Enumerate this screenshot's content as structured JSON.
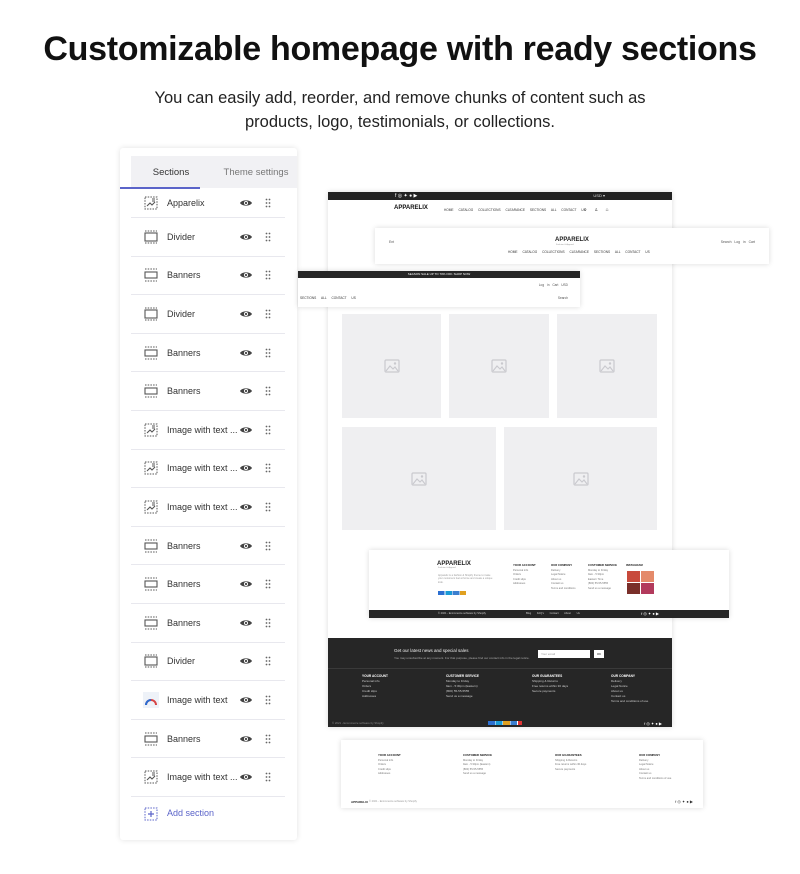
{
  "hero": {
    "title": "Customizable homepage with ready sections",
    "subtitle": "You can easily add, reorder, and remove chunks of content such as products, logo, testimonials, or collections."
  },
  "panel": {
    "tabs": [
      {
        "label": "Sections",
        "active": true
      },
      {
        "label": "Theme settings",
        "active": false
      }
    ],
    "sections": [
      {
        "label": "Apparelix",
        "icon": "image-text-icon"
      },
      {
        "label": "Divider",
        "icon": "divider-icon"
      },
      {
        "label": "Banners",
        "icon": "banner-icon"
      },
      {
        "label": "Divider",
        "icon": "divider-icon"
      },
      {
        "label": "Banners",
        "icon": "banner-icon"
      },
      {
        "label": "Banners",
        "icon": "banner-icon"
      },
      {
        "label": "Image with text ...",
        "icon": "image-text-icon"
      },
      {
        "label": "Image with text ...",
        "icon": "image-text-icon"
      },
      {
        "label": "Image with text ...",
        "icon": "image-text-icon"
      },
      {
        "label": "Banners",
        "icon": "banner-icon"
      },
      {
        "label": "Banners",
        "icon": "banner-icon"
      },
      {
        "label": "Banners",
        "icon": "banner-icon"
      },
      {
        "label": "Divider",
        "icon": "divider-icon"
      },
      {
        "label": "Image with text",
        "icon": "image-thumbnail-icon"
      },
      {
        "label": "Banners",
        "icon": "banner-icon"
      },
      {
        "label": "Image with text ...",
        "icon": "image-text-icon"
      }
    ],
    "add_label": "Add section",
    "accent": "#5b64c9"
  },
  "preview": {
    "logo": "APPARELIX",
    "nav": "HOME CATALOG COLLECTIONS CLEARANCE SECTIONS ALL CONTACT US",
    "header2": {
      "left": "Ent",
      "logo": "APPARELIX",
      "tagline": "Fashion & Apparel",
      "nav": "HOME CATALOG COLLECTIONS CLEARANCE SECTIONS ALL CONTACT US",
      "right": "Search Log in Cart"
    },
    "header3": {
      "promo": "SEASON SALE UP TO 70% OFF. SHOP NOW",
      "right": "Log in Cart USD",
      "nav": "SECTIONS ALL CONTACT US",
      "search": "Search"
    },
    "newsletter": {
      "title": "Get our latest news and special sales",
      "text": "You may unsubscribe at any moment. For that purpose, please find our contact info in the legal notice.",
      "placeholder": "Your email",
      "button": "OK",
      "columns": [
        {
          "title": "YOUR ACCOUNT",
          "items": [
            "Personal info",
            "Orders",
            "Credit slips",
            "Addresses"
          ]
        },
        {
          "title": "CUSTOMER SERVICE",
          "items": [
            "Monday to Friday",
            "9am - 5:30pm (Eastern)",
            "(800) 55-55-5555",
            "Send us a message"
          ]
        },
        {
          "title": "OUR GUARANTEES",
          "items": [
            "Shipping & Returns",
            "Free returns within 30 days",
            "Secure payments"
          ]
        },
        {
          "title": "OUR COMPANY",
          "items": [
            "Delivery",
            "Legal Notice",
            "About us",
            "Contact us",
            "Terms and conditions of use"
          ]
        }
      ],
      "copyright": "© 2021 - Ecommerce software by Shopify"
    },
    "footer1": {
      "logo": "APPARELIX",
      "tagline": "Fashion & Apparel",
      "desc": "Apparelix is a fashion & Shopify theme to make your customers feel at home and create a unique look.",
      "columns": [
        {
          "title": "YOUR ACCOUNT",
          "items": [
            "Personal info",
            "Orders",
            "Credit slips",
            "Addresses"
          ]
        },
        {
          "title": "OUR COMPANY",
          "items": [
            "Delivery",
            "Legal Notice",
            "About us",
            "Contact us",
            "Terms and conditions"
          ]
        },
        {
          "title": "CUSTOMER SERVICE",
          "items": [
            "Monday to Friday",
            "9am - 5:30pm",
            "Eastern Time",
            "(800) 55-55-5555",
            "Send us a message"
          ]
        },
        {
          "title": "INSTAGRAM",
          "items": []
        }
      ],
      "copyright": "© 2021 - Ecommerce software by Shopify",
      "menu": "Blog FAQ's Contact About Us"
    },
    "footer2": {
      "logo": "APPARELIX",
      "copyright": "© 2021 - Ecommerce software by Shopify",
      "columns": [
        {
          "title": "YOUR ACCOUNT",
          "items": [
            "Personal info",
            "Orders",
            "Credit slips",
            "Addresses"
          ]
        },
        {
          "title": "CUSTOMER SERVICE",
          "items": [
            "Monday to Friday",
            "9am - 5:30pm (Eastern)",
            "(800) 55-55-5555",
            "Send us a message"
          ]
        },
        {
          "title": "OUR GUARANTEES",
          "items": [
            "Shipping & Returns",
            "Free returns within 30 days",
            "Secure payments"
          ]
        },
        {
          "title": "OUR COMPANY",
          "items": [
            "Delivery",
            "Legal Notice",
            "About us",
            "Contact us",
            "Terms and conditions of use"
          ]
        }
      ]
    }
  }
}
